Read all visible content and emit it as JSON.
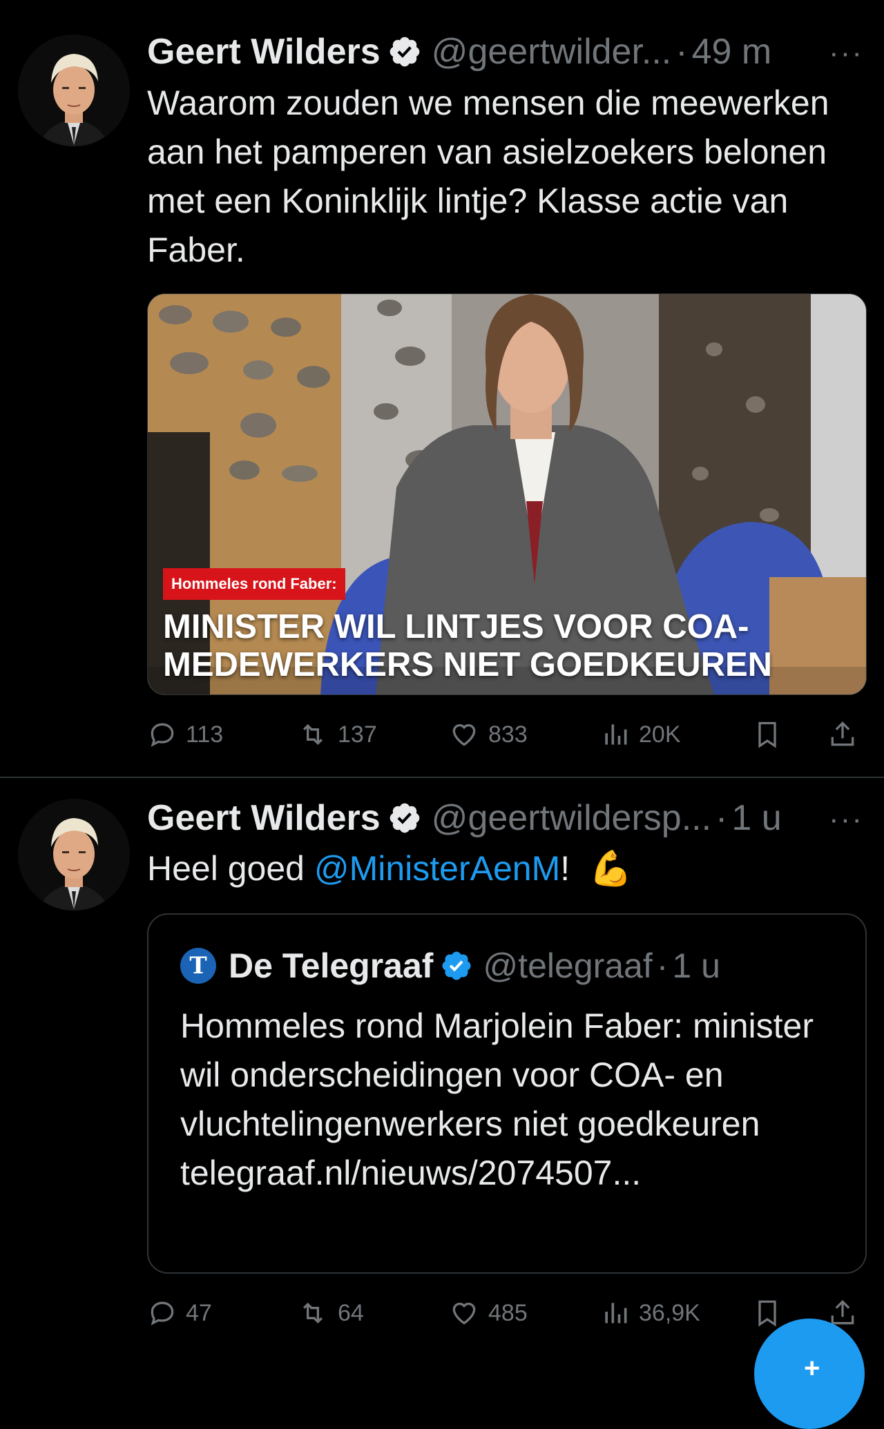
{
  "tweets": [
    {
      "author_name": "Geert Wilders",
      "handle": "@geertwilder...",
      "separator": "·",
      "time": "49 m",
      "more": "···",
      "text": "Waarom zouden we mensen die meewerken aan het pamperen van asielzoekers belonen met een Koninklijk lintje? Klasse actie van Faber.",
      "media": {
        "tag": "Hommeles rond Faber:",
        "headline": "MINISTER WIL LINTJES VOOR COA-MEDEWERKERS NIET GOEDKEUREN"
      },
      "stats": {
        "replies": "113",
        "reposts": "137",
        "likes": "833",
        "views": "20K"
      }
    },
    {
      "author_name": "Geert Wilders",
      "handle": "@geertwildersp...",
      "separator": "·",
      "time": "1 u",
      "more": "···",
      "text_before": "Heel goed ",
      "mention": "@MinisterAenM",
      "text_after": "!",
      "emoji": "💪",
      "quote": {
        "logo_letter": "T",
        "name": "De Telegraaf",
        "handle": "@telegraaf",
        "separator": "·",
        "time": "1 u",
        "text": "Hommeles rond Marjolein Faber: minister wil onderscheidingen voor COA- en vluchtelingenwerkers niet goedkeuren telegraaf.nl/nieuws/2074507..."
      },
      "stats": {
        "replies": "47",
        "reposts": "64",
        "likes": "485",
        "views": "36,9K"
      }
    }
  ],
  "colors": {
    "background": "#000000",
    "accent": "#1d9bf0",
    "muted": "#71767b",
    "text": "#e7e9ea",
    "tag_red": "#d7141a"
  },
  "icons": [
    "verified-badge-icon",
    "more-icon",
    "reply-icon",
    "repost-icon",
    "like-icon",
    "views-icon",
    "bookmark-icon",
    "share-icon",
    "compose-icon"
  ]
}
